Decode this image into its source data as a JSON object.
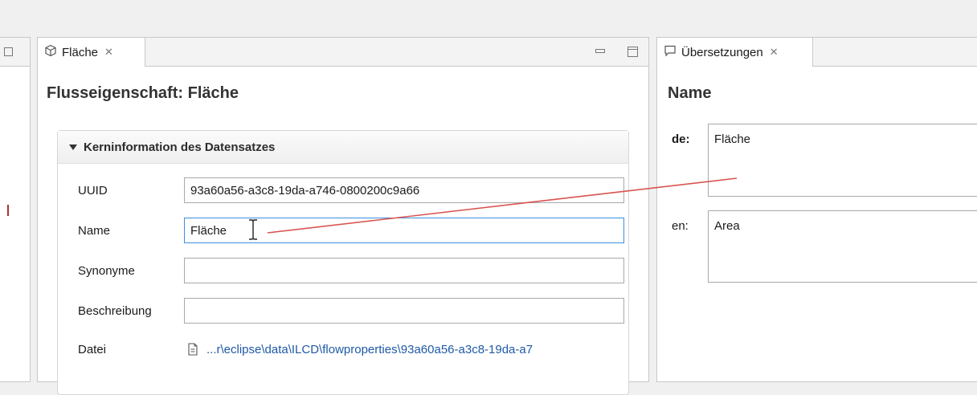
{
  "left_panel": {
    "tab_label": "Fläche",
    "title": "Flusseigenschaft: Fläche",
    "section_title": "Kerninformation des Datensatzes",
    "fields": {
      "uuid_label": "UUID",
      "uuid_value": "93a60a56-a3c8-19da-a746-0800200c9a66",
      "name_label": "Name",
      "name_value": "Fläche",
      "synonyms_label": "Synonyme",
      "synonyms_value": "",
      "description_label": "Beschreibung",
      "description_value": "",
      "file_label": "Datei",
      "file_value": "...r\\eclipse\\data\\ILCD\\flowproperties\\93a60a56-a3c8-19da-a7"
    }
  },
  "right_panel": {
    "tab_label": "Übersetzungen",
    "title": "Name",
    "translations": [
      {
        "lang": "de:",
        "text": "Fläche"
      },
      {
        "lang": "en:",
        "text": "Area"
      }
    ]
  },
  "colors": {
    "link": "#1f5aa6",
    "marker": "#d9534f"
  },
  "icons": [
    "cube-icon",
    "close-icon",
    "minimize-icon",
    "maximize-icon",
    "speech-bubble-icon",
    "triangle-down-icon",
    "file-icon",
    "text-cursor-icon"
  ]
}
